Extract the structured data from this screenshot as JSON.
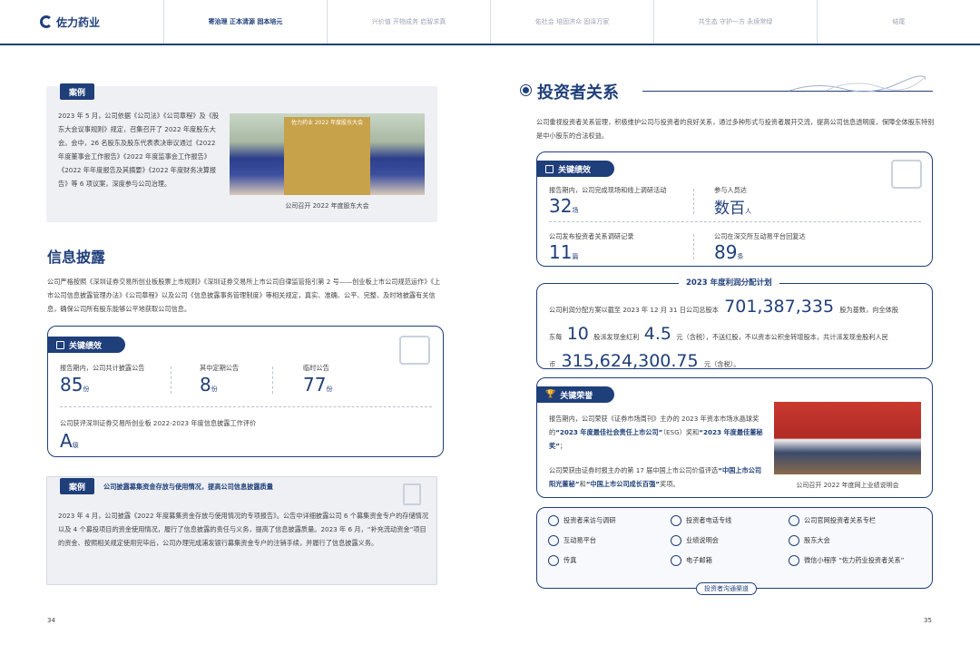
{
  "nav": {
    "logo": "佐力药业",
    "tabs": [
      "寄治理 正本清源 固本培元",
      "兴价值 开物成务 启智求真",
      "佑社会 培固济众 固泽万家",
      "共生态 守护一方 永续常绿",
      "结尾"
    ]
  },
  "left": {
    "case1": {
      "badge": "案例",
      "text": "2023 年 5 月，公司依据《公司法》《公司章程》及《股东大会议事规则》规定，召集召开了 2022 年度股东大会。会中，26 名股东及股东代表表决审议通过《2022 年度董事会工作报告》《2022 年度监事会工作报告》《2022 年年度报告及其摘要》《2022 年度财务决算报告》等 6 项议案，深度参与公司治理。",
      "photo_banner": "佐力药业 2022 年度股东大会",
      "caption": "公司召开 2022 年度股东大会"
    },
    "disclosure": {
      "title": "信息披露",
      "text": "公司严格按照《深圳证券交易所创业板股票上市规则》《深圳证券交易所上市公司自律监管指引第 2 号——创业板上市公司规范运作》《上市公司信息披露管理办法》《公司章程》以及公司《信息披露事务管理制度》等相关规定，真实、准确、公平、完整、及时地披露有关信息，确保公司所有股东能够公平地获取公司信息。"
    },
    "kpi": {
      "pill": "关键绩效",
      "items": [
        {
          "label": "报告期内，公司共计披露公告",
          "value": "85",
          "unit": "份"
        },
        {
          "label": "其中定期公告",
          "value": "8",
          "unit": "份"
        },
        {
          "label": "临时公告",
          "value": "77",
          "unit": "份"
        }
      ],
      "rating_label": "公司获评深圳证券交易所创业板 2022-2023 年度信息披露工作评价",
      "rating_value": "A",
      "rating_unit": "级"
    },
    "case2": {
      "badge": "案例",
      "title": "公司披露募集资金存放与使用情况，提高公司信息披露质量",
      "text": "2023 年 4 月，公司披露《2022 年度募集资金存放与使用情况的专项报告》。公告中详细披露公司 6 个募集资金专户的存储情况以及 4 个募投项目的资金使用情况，履行了信息披露的责任与义务，提高了信息披露质量。2023 年 6 月，“补充流动资金”项目的资金、按照相关规定使用完毕后，公司办理完成浦发银行募集资金专户的注销手续，并履行了信息披露义务。"
    },
    "page": "34"
  },
  "right": {
    "title": "投资者关系",
    "intro": "公司重视投资者关系管理，积极维护公司与投资者的良好关系，通过多种形式与投资者展开交流，提高公司信息透明度，保障全体股东特别是中小股东的合法权益。",
    "kpi": {
      "pill": "关键绩效",
      "items": [
        {
          "label": "报告期内，公司完成现场和线上调研活动",
          "value": "32",
          "unit": "场"
        },
        {
          "label": "参与人员达",
          "value": "数百",
          "unit": "人"
        },
        {
          "label": "公司发布投资者关系调研记录",
          "value": "11",
          "unit": "篇"
        },
        {
          "label": "公司在深交所互动易平台回复达",
          "value": "89",
          "unit": "条"
        }
      ]
    },
    "dividend": {
      "title": "2023 年度利润分配计划",
      "t1": "公司利润分配方案以截至 2023 年 12 月 31 日公司总股本",
      "v1": "701,387,335",
      "t2": "股为基数，向全体股",
      "t3": "东每",
      "v2": "10",
      "t4": "股派发现金红利",
      "v3": "4.5",
      "t5": "元（含税），不送红股，不以资本公积金转增股本，共计派发现金股利人民",
      "t6": "币",
      "v4": "315,624,300.75",
      "t7": "元（含税）。"
    },
    "honor": {
      "pill": "关键荣誉",
      "p1a": "报告期内，公司荣获《证券市场周刊》主办的 2023 年资本市场水晶球奖的",
      "p1b": "“2023 年度最佳社会责任上市公司”",
      "p1c": "（ESG）奖和",
      "p1d": "“2023 年度最佳董秘奖”",
      "p1e": "；",
      "p2a": "公司荣获由证券时报主办的第 17 届中国上市公司价值评选",
      "p2b": "“中国上市公司阳光董秘”",
      "p2c": "和",
      "p2d": "“中国上市公司成长百强”",
      "p2e": "奖项。",
      "caption": "公司召开 2022 年度网上业绩说明会"
    },
    "channels": {
      "items": [
        "投资者来访与调研",
        "投资者电话专线",
        "公司官网投资者关系专栏",
        "互动易平台",
        "业绩说明会",
        "股东大会",
        "传真",
        "电子邮箱",
        "微信小程序 “佐力药业投资者关系”"
      ],
      "icons": [
        "visit-icon",
        "phone-icon",
        "web-icon",
        "chat-icon",
        "presentation-icon",
        "meeting-icon",
        "fax-icon",
        "mail-icon",
        "wechat-icon"
      ],
      "tag": "投资者沟通渠道"
    },
    "page": "35"
  }
}
